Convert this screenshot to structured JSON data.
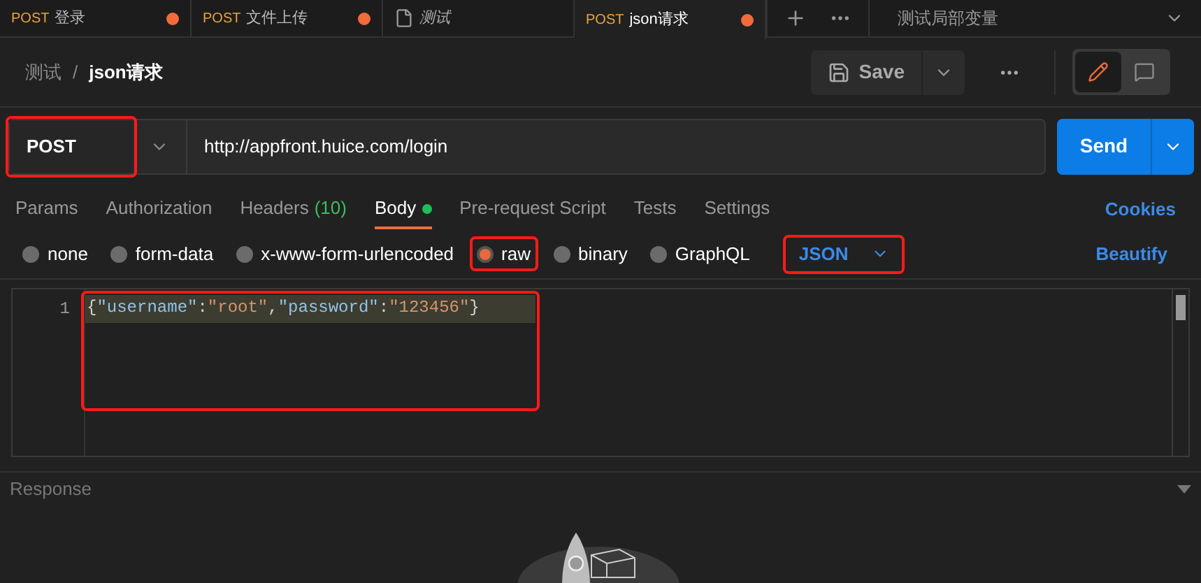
{
  "request_tabs": [
    {
      "kind": "request",
      "method": "POST",
      "name": "登录",
      "unsaved": true,
      "selected": false
    },
    {
      "kind": "request",
      "method": "POST",
      "name": "文件上传",
      "unsaved": true,
      "selected": false
    },
    {
      "kind": "document",
      "name": "测试",
      "unsaved": false,
      "selected": false
    },
    {
      "kind": "request",
      "method": "POST",
      "name": "json请求",
      "unsaved": true,
      "selected": true
    }
  ],
  "environment": "测试局部变量",
  "breadcrumb": {
    "parent": "测试",
    "separator": "/",
    "current": "json请求"
  },
  "save_button": "Save",
  "method": "POST",
  "url": "http://appfront.huice.com/login",
  "send_button": "Send",
  "tabs": [
    {
      "label": "Params",
      "selected": false
    },
    {
      "label": "Authorization",
      "selected": false
    },
    {
      "label": "Headers",
      "count": "(10)",
      "selected": false
    },
    {
      "label": "Body",
      "has_content": true,
      "selected": true
    },
    {
      "label": "Pre-request Script",
      "selected": false
    },
    {
      "label": "Tests",
      "selected": false
    },
    {
      "label": "Settings",
      "selected": false
    }
  ],
  "cookies_link": "Cookies",
  "body_types": [
    {
      "label": "none",
      "selected": false
    },
    {
      "label": "form-data",
      "selected": false
    },
    {
      "label": "x-www-form-urlencoded",
      "selected": false
    },
    {
      "label": "raw",
      "selected": true
    },
    {
      "label": "binary",
      "selected": false
    },
    {
      "label": "GraphQL",
      "selected": false
    }
  ],
  "format": "JSON",
  "beautify_link": "Beautify",
  "editor": {
    "lines": [
      {
        "number": "1",
        "tokens": [
          {
            "kind": "punct",
            "text": "{"
          },
          {
            "kind": "key",
            "text": "\"username\""
          },
          {
            "kind": "punct",
            "text": ":"
          },
          {
            "kind": "string",
            "text": "\"root\""
          },
          {
            "kind": "punct",
            "text": ","
          },
          {
            "kind": "key",
            "text": "\"password\""
          },
          {
            "kind": "punct",
            "text": ":"
          },
          {
            "kind": "string",
            "text": "\"123456\""
          },
          {
            "kind": "punct",
            "text": "}"
          }
        ]
      }
    ]
  },
  "response": {
    "title": "Response"
  }
}
